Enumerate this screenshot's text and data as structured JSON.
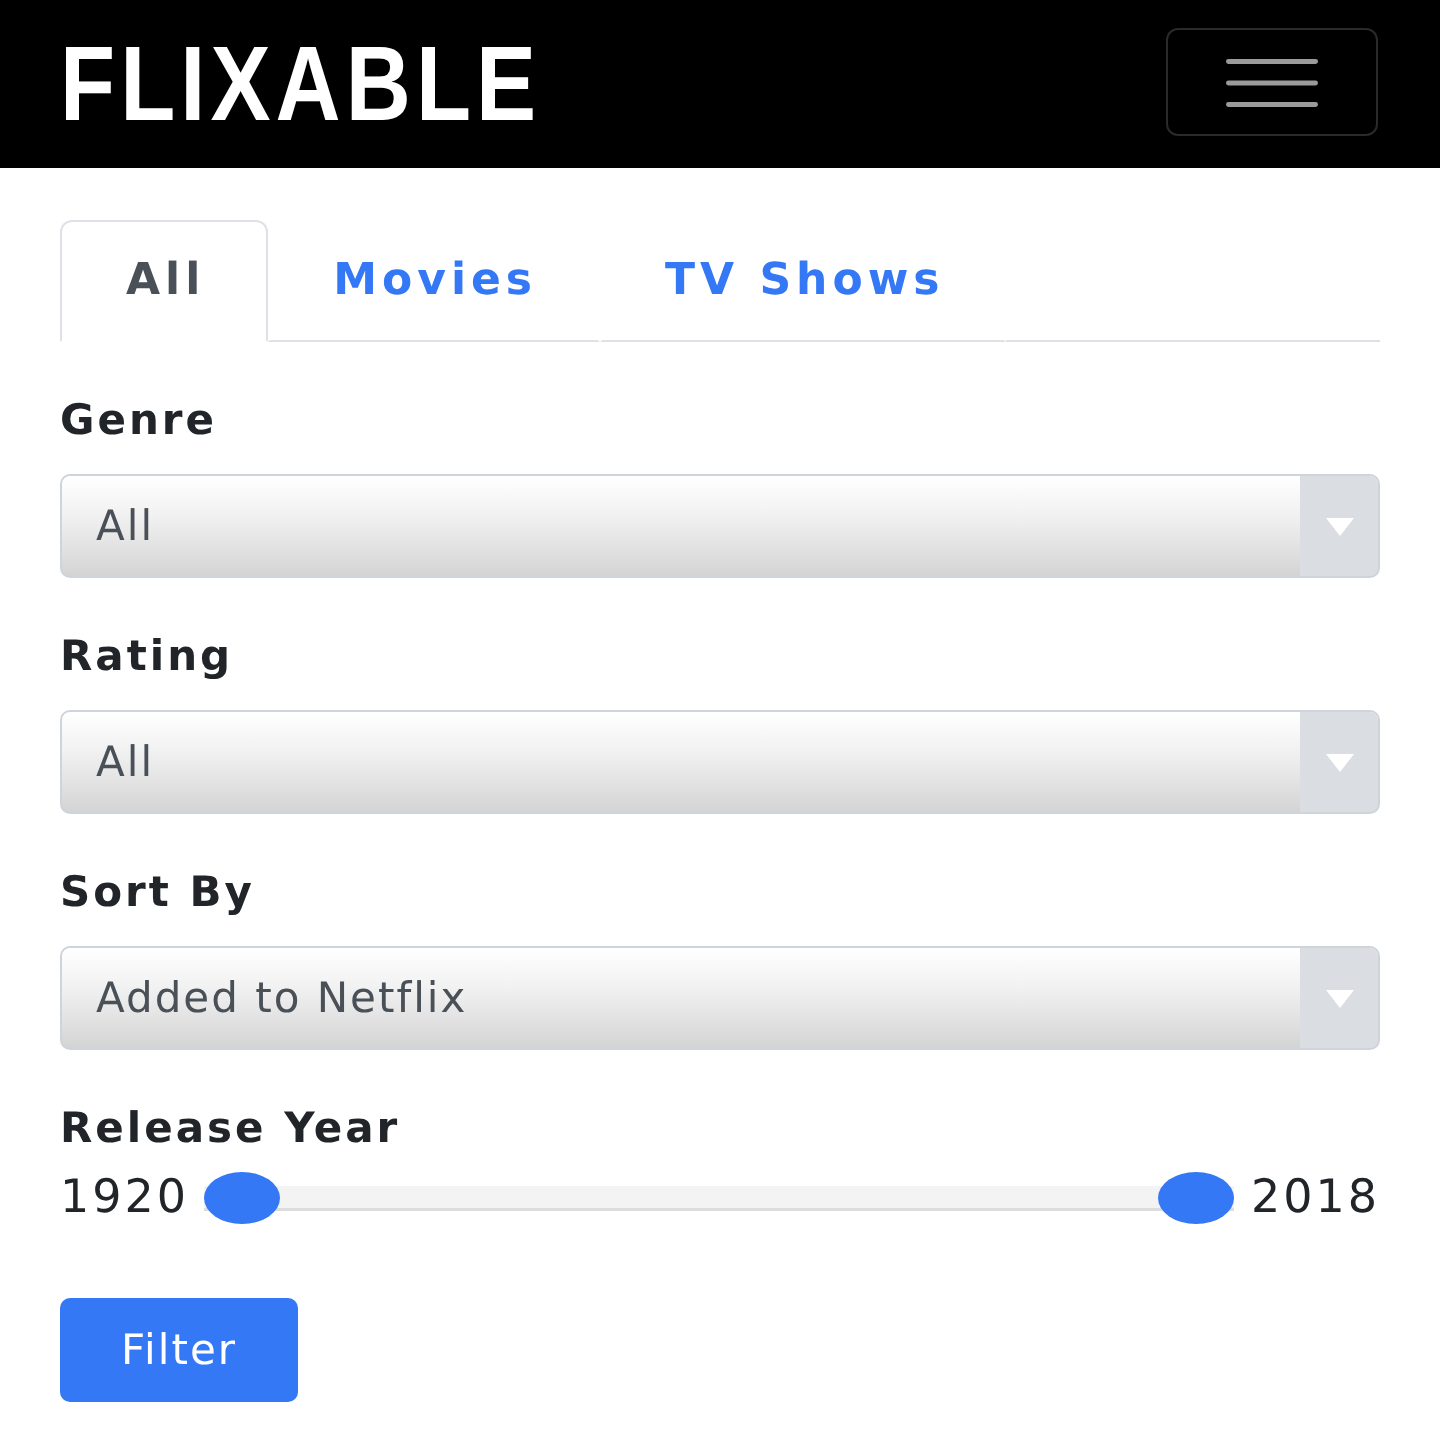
{
  "header": {
    "logo": "FLIXABLE"
  },
  "tabs": [
    {
      "label": "All",
      "selected": true
    },
    {
      "label": "Movies",
      "selected": false
    },
    {
      "label": "TV Shows",
      "selected": false
    }
  ],
  "filters": [
    {
      "label": "Genre",
      "value": "All"
    },
    {
      "label": "Rating",
      "value": "All"
    },
    {
      "label": "Sort By",
      "value": "Added to Netflix"
    }
  ],
  "release_year": {
    "label": "Release Year",
    "min_label": "1920",
    "max_label": "2018",
    "thumbs": [
      {
        "level": 0
      },
      {
        "level": 1
      }
    ]
  },
  "buttons": [
    {
      "label": "Filter"
    }
  ]
}
